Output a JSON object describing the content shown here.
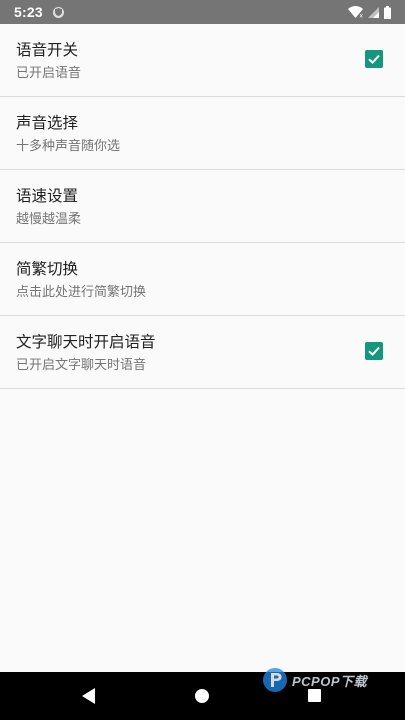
{
  "status_bar": {
    "time": "5:23",
    "icons": [
      "shield-icon",
      "wifi-icon",
      "cell-signal-icon",
      "battery-icon"
    ]
  },
  "settings": [
    {
      "title": "语音开关",
      "summary": "已开启语音",
      "checked": true
    },
    {
      "title": "声音选择",
      "summary": "十多种声音随你选",
      "checked": null
    },
    {
      "title": "语速设置",
      "summary": "越慢越温柔",
      "checked": null
    },
    {
      "title": "简繁切换",
      "summary": "点击此处进行简繁切换",
      "checked": null
    },
    {
      "title": "文字聊天时开启语音",
      "summary": "已开启文字聊天时语音",
      "checked": true
    }
  ],
  "nav_bar": {
    "icons": [
      "back-icon",
      "home-icon",
      "recents-icon"
    ]
  },
  "watermark": {
    "text": "PCPOP下载"
  },
  "colors": {
    "accent": "#15967f",
    "status_bar": "#757575",
    "background": "#fafafa",
    "nav_bar": "#000000"
  }
}
